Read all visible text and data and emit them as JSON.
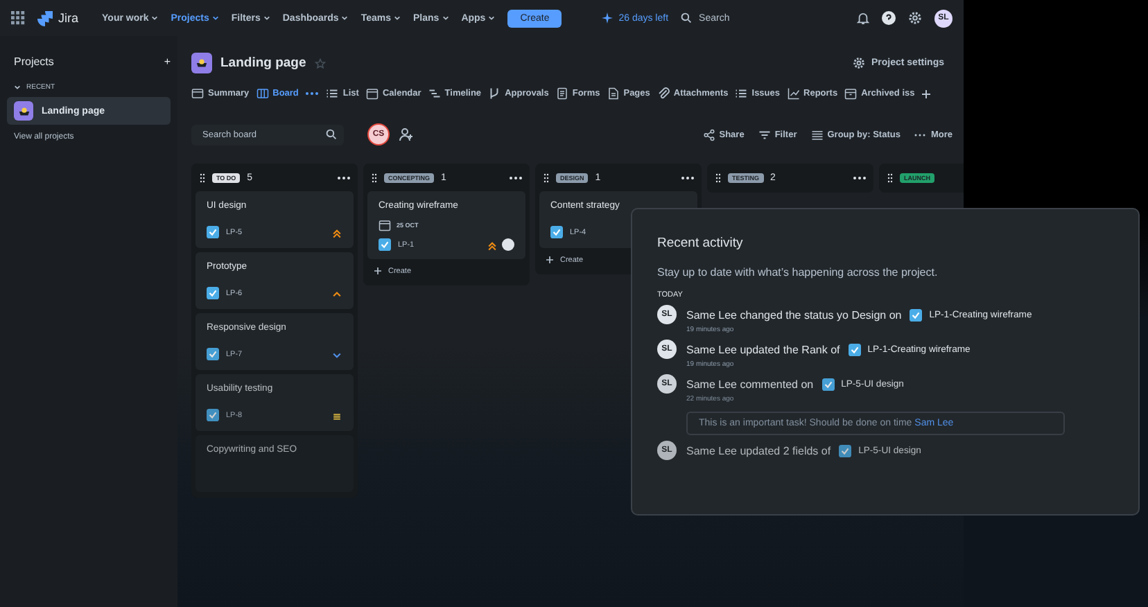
{
  "top_nav": {
    "product": "Jira",
    "items": [
      {
        "label": "Your work",
        "selected": false
      },
      {
        "label": "Projects",
        "selected": true
      },
      {
        "label": "Filters",
        "selected": false
      },
      {
        "label": "Dashboards",
        "selected": false
      },
      {
        "label": "Teams",
        "selected": false
      },
      {
        "label": "Plans",
        "selected": false
      },
      {
        "label": "Apps",
        "selected": false
      }
    ],
    "create_button": "Create",
    "trial": "26 days left",
    "search": {
      "placeholder": "Search"
    },
    "avatar": "SL"
  },
  "sidebar": {
    "title": "Projects",
    "add": "+",
    "section": "RECENT",
    "items": [
      {
        "label": "Landing page",
        "selected": true
      }
    ],
    "view_all": "View all projects"
  },
  "project": {
    "title": "Landing page",
    "settings": "Project settings"
  },
  "tabs": [
    {
      "label": "Summary",
      "selected": false
    },
    {
      "label": "Board",
      "selected": true
    },
    {
      "label": "List",
      "selected": false
    },
    {
      "label": "Calendar",
      "selected": false
    },
    {
      "label": "Timeline",
      "selected": false
    },
    {
      "label": "Approvals",
      "selected": false
    },
    {
      "label": "Forms",
      "selected": false
    },
    {
      "label": "Pages",
      "selected": false
    },
    {
      "label": "Attachments",
      "selected": false
    },
    {
      "label": "Issues",
      "selected": false
    },
    {
      "label": "Reports",
      "selected": false
    },
    {
      "label": "Archived iss",
      "selected": false
    }
  ],
  "toolbar": {
    "search": {
      "placeholder": "Search board"
    },
    "avatar": "CS",
    "actions": [
      "Share",
      "Filter",
      "Group by: Status",
      "More"
    ]
  },
  "columns": [
    {
      "status": "TO DO",
      "color": "#dfe1e6",
      "count": "5",
      "cards": [
        {
          "title": "UI design",
          "key": "LP-5",
          "kind": "high"
        },
        {
          "title": "Prototype",
          "key": "LP-6",
          "kind": "medium"
        },
        {
          "title": "Responsive design",
          "key": "LP-7",
          "kind": "low"
        },
        {
          "title": "Usability testing",
          "key": "LP-8",
          "kind": "flat"
        },
        {
          "title": "Copywriting and SEO"
        }
      ]
    },
    {
      "status": "CONCEPTING",
      "color": "#8c9bab",
      "count": "1",
      "cards": [
        {
          "title": "Creating wireframe",
          "date": "25 OCT",
          "key": "LP-1",
          "kind": "high",
          "assignee": true
        }
      ],
      "create": "Create"
    },
    {
      "status": "DESIGN",
      "color": "#8c9bab",
      "count": "1",
      "cards": [
        {
          "title": "Content strategy",
          "key": "LP-4"
        }
      ],
      "create": "Create"
    },
    {
      "status": "TESTING",
      "color": "#8c9bab",
      "count": "2"
    },
    {
      "status": "LAUNCH",
      "color": "#22a06b"
    }
  ],
  "activity_panel": {
    "title": "Recent activity",
    "subtitle": "Stay up to date with what’s happening across the project.",
    "section": "TODAY",
    "entries": [
      {
        "avatar": "SL",
        "text": "Same Lee changed the status yo Design on",
        "issue": "LP-1-Creating wireframe",
        "time": "19 minutes ago"
      },
      {
        "avatar": "SL",
        "text": "Same Lee updated the Rank of",
        "issue": "LP-1-Creating wireframe",
        "time": "19 minutes ago"
      },
      {
        "avatar": "SL",
        "text": "Same Lee commented on",
        "issue": "LP-5-UI design",
        "time": "22 minutes ago",
        "comment": "This is an important task! Should be done on time",
        "mention": "Sam Lee"
      },
      {
        "avatar": "SL",
        "text": "Same Lee updated 2 fields of",
        "issue": "LP-5-UI design"
      }
    ]
  }
}
